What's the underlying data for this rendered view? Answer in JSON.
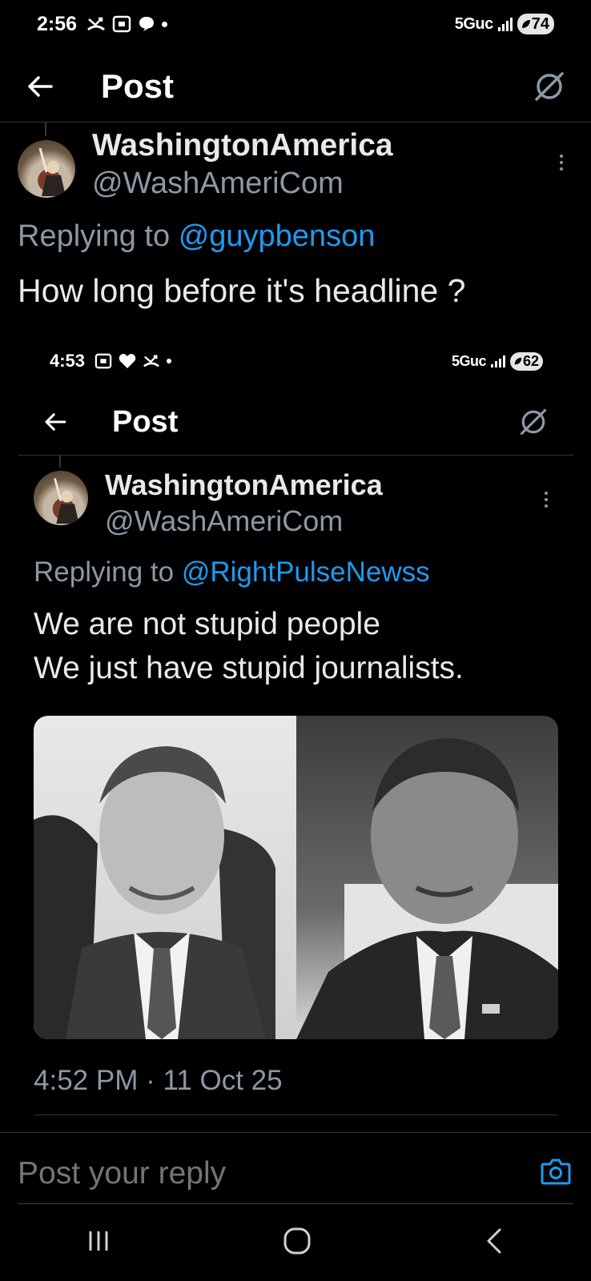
{
  "outer": {
    "status": {
      "time": "2:56",
      "network": "5Guc",
      "battery": "74"
    },
    "header": {
      "title": "Post"
    },
    "tweet": {
      "display_name": "WashingtonAmerica",
      "handle": "@WashAmeriCom",
      "replying_prefix": "Replying to",
      "replying_to": "@guypbenson",
      "text": "How long before it's headline ?"
    },
    "reply_placeholder": "Post your reply"
  },
  "embedded": {
    "status": {
      "time": "4:53",
      "network": "5Guc",
      "battery": "62"
    },
    "header": {
      "title": "Post"
    },
    "tweet": {
      "display_name": "WashingtonAmerica",
      "handle": "@WashAmeriCom",
      "replying_prefix": "Replying to",
      "replying_to": "@RightPulseNewss",
      "text_line1": "We are not stupid people",
      "text_line2": "We just have stupid journalists.",
      "timestamp": "4:52 PM · 11 Oct 25"
    }
  },
  "colors": {
    "background": "#000000",
    "text": "#e7e9ea",
    "secondary": "#8b98a5",
    "accent": "#1d9bf0",
    "divider": "#2f3336"
  },
  "icons": {
    "back": "arrow-left-icon",
    "grok": "slashed-circle-icon",
    "more": "more-vertical-icon",
    "camera": "camera-icon",
    "nav_recents": "recents-icon",
    "nav_home": "home-icon",
    "nav_back": "nav-back-icon"
  }
}
